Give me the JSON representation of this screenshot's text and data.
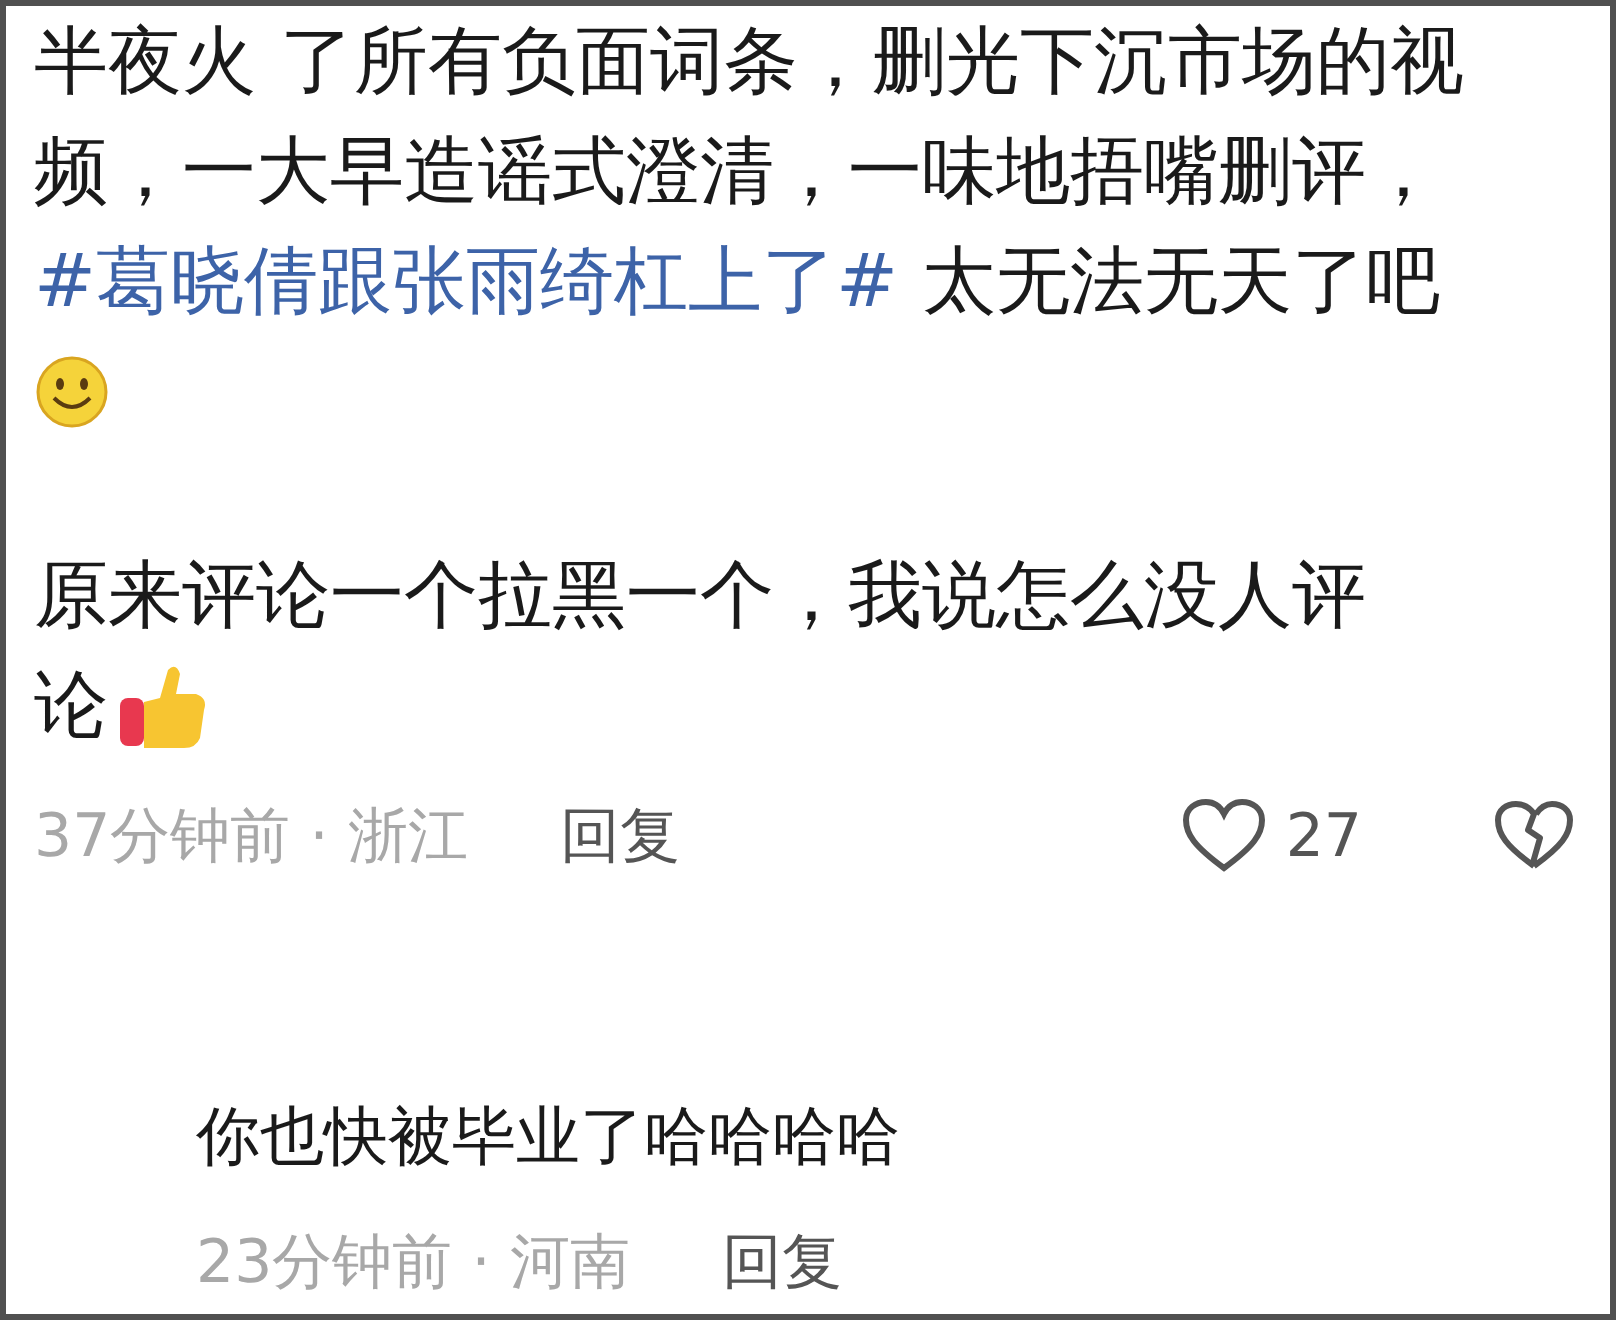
{
  "comment": {
    "paragraph_1": {
      "text": "半夜火 了所有负面词条，删光下沉市场的视频，一大早造谣式澄清，一味地捂嘴删评，",
      "hashtag": "#葛晓倩跟张雨绮杠上了#",
      "text_after": "太无法无天了吧"
    },
    "paragraph_2_lines": [
      "原来评论一个拉黑一个，我说怎么没人评",
      "论"
    ],
    "time_location": "37分钟前 · 浙江",
    "reply_button": "回复",
    "like_count": "27"
  },
  "reply": {
    "text": "你也快被毕业了哈哈哈哈",
    "time_location": "23分钟前 · 河南",
    "reply_button": "回复"
  }
}
